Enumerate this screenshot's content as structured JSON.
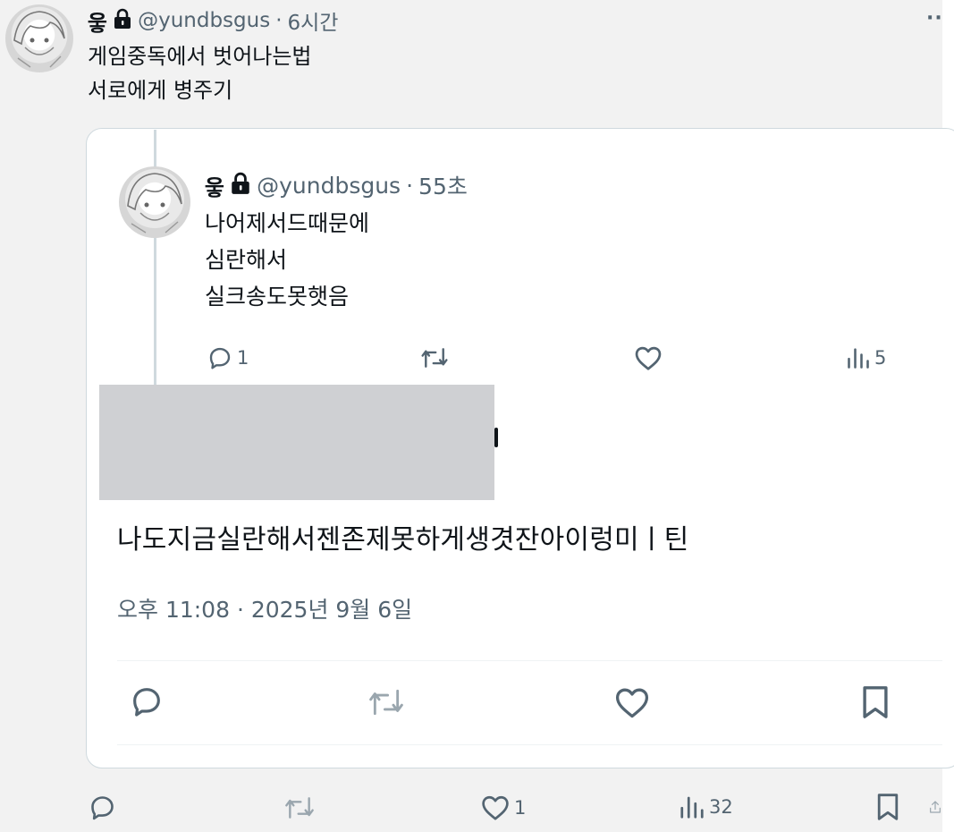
{
  "outer_tweet": {
    "display_name": "웋",
    "handle": "@yundbsgus",
    "separator": "·",
    "time": "6시간",
    "more": "··",
    "text_lines": [
      "게임중독에서 벗어나는법",
      "서로에게 병주기"
    ],
    "actions": {
      "reply_count": "",
      "repost_count": "",
      "like_count": "1",
      "views_count": "32"
    }
  },
  "quoted": {
    "reply": {
      "display_name": "웋",
      "handle": "@yundbsgus",
      "separator": "·",
      "time": "55초",
      "text_lines": [
        "나어제서드때문에",
        "심란해서",
        "실크송도못햇음"
      ],
      "actions": {
        "reply_count": "1",
        "views_count": "5"
      }
    },
    "main_text": "나도지금실란해서젠존제못하게생겻잔아이렁미ㅣ틴",
    "timestamp": "오후 11:08 · 2025년 9월 6일"
  },
  "colors": {
    "text": "#0f1419",
    "secondary": "#536471",
    "border": "#cfd9de",
    "redaction": "#cfd0d3"
  }
}
